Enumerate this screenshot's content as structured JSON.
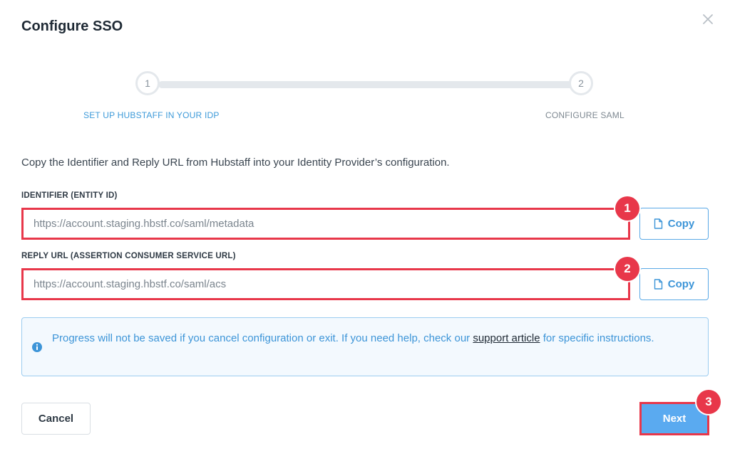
{
  "dialog": {
    "title": "Configure SSO",
    "close_icon": "close-icon"
  },
  "stepper": {
    "steps": [
      {
        "number": "1",
        "label": "SET UP HUBSTAFF IN YOUR IDP",
        "state": "active"
      },
      {
        "number": "2",
        "label": "CONFIGURE SAML",
        "state": "inactive"
      }
    ]
  },
  "intro": "Copy the Identifier and Reply URL from Hubstaff into your Identity Provider’s configuration.",
  "fields": [
    {
      "label": "IDENTIFIER (ENTITY ID)",
      "value": "https://account.staging.hbstf.co/saml/metadata",
      "copy_label": "Copy",
      "badge": "1"
    },
    {
      "label": "REPLY URL (ASSERTION CONSUMER SERVICE URL)",
      "value": "https://account.staging.hbstf.co/saml/acs",
      "copy_label": "Copy",
      "badge": "2"
    }
  ],
  "notice": {
    "icon": "info-icon",
    "text_before": "Progress will not be saved if you cancel configuration or exit. If you need help, check our ",
    "link_text": "support article",
    "text_after": " for specific instructions."
  },
  "footer": {
    "cancel_label": "Cancel",
    "next_label": "Next",
    "next_badge": "3"
  },
  "colors": {
    "accent": "#3d95d8",
    "primary_button": "#5aaaf0",
    "highlight": "#e8374a",
    "notice_bg": "#f3f9fe"
  }
}
